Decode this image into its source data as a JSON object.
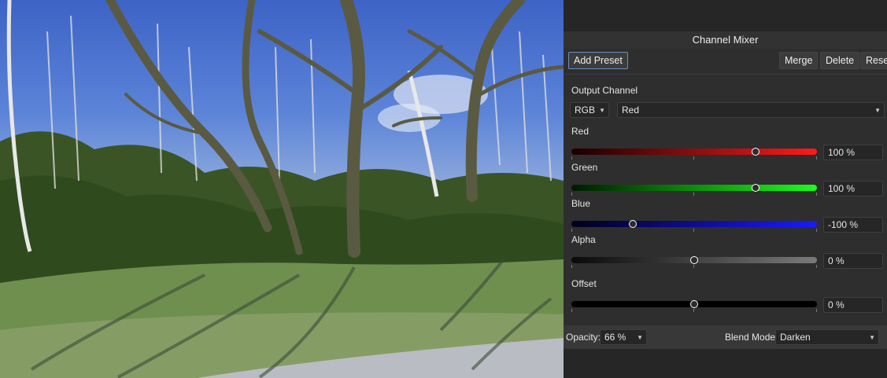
{
  "canvas": {
    "description_icon": "photo-canvas"
  },
  "panel": {
    "title": "Channel Mixer",
    "buttons": {
      "add_preset": "Add Preset",
      "merge": "Merge",
      "delete": "Delete",
      "reset": "Reset"
    },
    "output_channel_label": "Output Channel",
    "color_space": "RGB",
    "channel": "Red",
    "sliders": [
      {
        "label": "Red",
        "value_text": "100 %",
        "value": 100,
        "min": -200,
        "max": 200
      },
      {
        "label": "Green",
        "value_text": "100 %",
        "value": 100,
        "min": -200,
        "max": 200
      },
      {
        "label": "Blue",
        "value_text": "-100 %",
        "value": -100,
        "min": -200,
        "max": 200
      },
      {
        "label": "Alpha",
        "value_text": "0 %",
        "value": 0,
        "min": -200,
        "max": 200
      },
      {
        "label": "Offset",
        "value_text": "0 %",
        "value": 0,
        "min": -200,
        "max": 200
      }
    ],
    "footer": {
      "opacity_label": "Opacity:",
      "opacity_value": "66 %",
      "blend_label": "Blend Mode:",
      "blend_value": "Darken"
    }
  },
  "colors": {
    "red_gradient": [
      "#1a0000",
      "#ff1a1a"
    ],
    "green_gradient": [
      "#001a00",
      "#1aff1a"
    ],
    "blue_gradient": [
      "#00001a",
      "#1a1aff"
    ],
    "alpha_gradient": [
      "#0a0a0a",
      "#7a7a7a"
    ],
    "offset_gradient": [
      "#000000",
      "#000000"
    ]
  }
}
